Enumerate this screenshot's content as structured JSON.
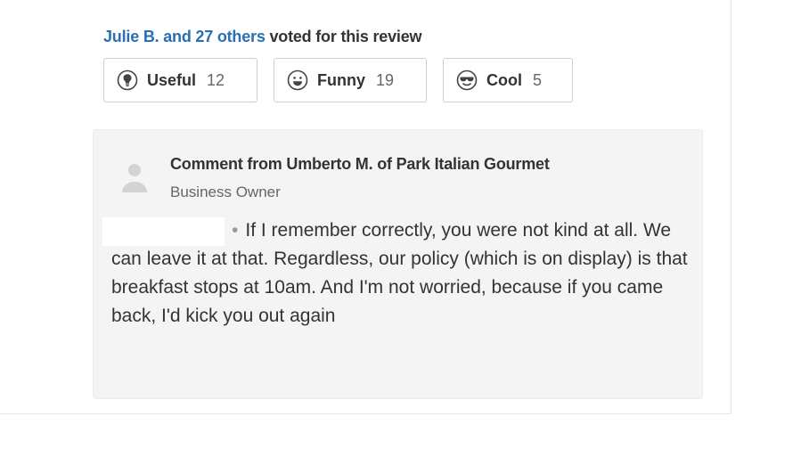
{
  "votes": {
    "voters_link": "Julie B. and 27 others",
    "voted_text": " voted for this review"
  },
  "buttons": [
    {
      "label": "Useful",
      "count": "12",
      "icon": "lightbulb-icon"
    },
    {
      "label": "Funny",
      "count": "19",
      "icon": "smile-icon"
    },
    {
      "label": "Cool",
      "count": "5",
      "icon": "sunglasses-icon"
    }
  ],
  "comment": {
    "from": "Comment from Umberto M. of Park Italian Gourmet",
    "role": "Business Owner",
    "bullet": "•",
    "body": "If I remember correctly, you were not kind at all. We can leave it at that. Regardless, our policy (which is on display) is that breakfast stops at 10am. And I'm not worried, because if you came back, I'd kick you out again"
  },
  "colors": {
    "link": "#2a6fb3",
    "text": "#333333",
    "comment_bg": "#f4f4f4"
  }
}
